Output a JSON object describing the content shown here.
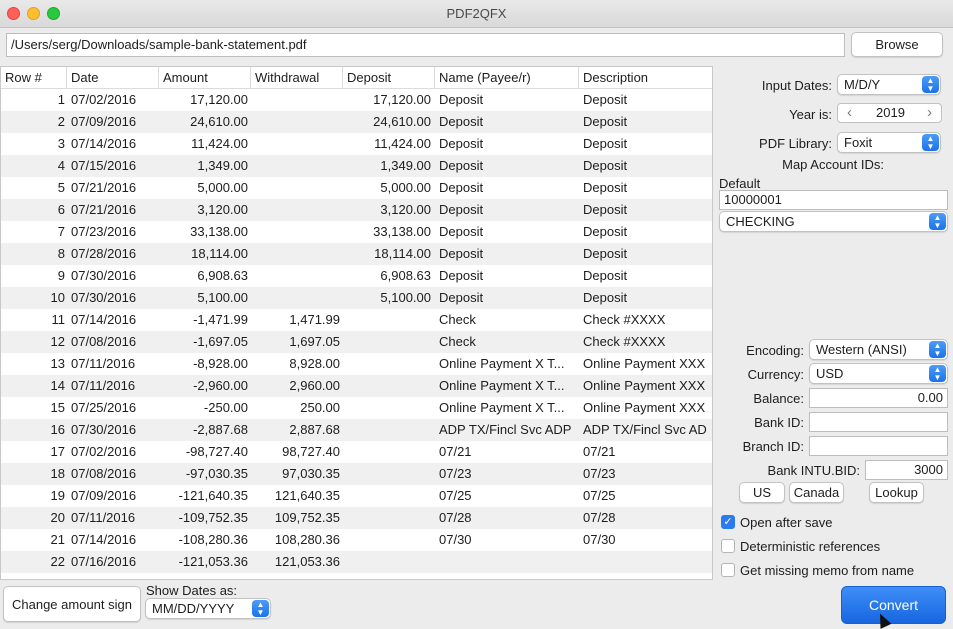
{
  "window": {
    "title": "PDF2QFX"
  },
  "file": {
    "path": "/Users/serg/Downloads/sample-bank-statement.pdf",
    "browse_label": "Browse"
  },
  "table": {
    "columns": [
      "Row #",
      "Date",
      "Amount",
      "Withdrawal",
      "Deposit",
      "Name (Payee/r)",
      "Description"
    ],
    "rows": [
      {
        "num": "1",
        "date": "07/02/2016",
        "amount": "17,120.00",
        "withdrawal": "",
        "deposit": "17,120.00",
        "name": "Deposit",
        "desc": "Deposit"
      },
      {
        "num": "2",
        "date": "07/09/2016",
        "amount": "24,610.00",
        "withdrawal": "",
        "deposit": "24,610.00",
        "name": "Deposit",
        "desc": "Deposit"
      },
      {
        "num": "3",
        "date": "07/14/2016",
        "amount": "11,424.00",
        "withdrawal": "",
        "deposit": "11,424.00",
        "name": "Deposit",
        "desc": "Deposit"
      },
      {
        "num": "4",
        "date": "07/15/2016",
        "amount": "1,349.00",
        "withdrawal": "",
        "deposit": "1,349.00",
        "name": "Deposit",
        "desc": "Deposit"
      },
      {
        "num": "5",
        "date": "07/21/2016",
        "amount": "5,000.00",
        "withdrawal": "",
        "deposit": "5,000.00",
        "name": "Deposit",
        "desc": "Deposit"
      },
      {
        "num": "6",
        "date": "07/21/2016",
        "amount": "3,120.00",
        "withdrawal": "",
        "deposit": "3,120.00",
        "name": "Deposit",
        "desc": "Deposit"
      },
      {
        "num": "7",
        "date": "07/23/2016",
        "amount": "33,138.00",
        "withdrawal": "",
        "deposit": "33,138.00",
        "name": "Deposit",
        "desc": "Deposit"
      },
      {
        "num": "8",
        "date": "07/28/2016",
        "amount": "18,114.00",
        "withdrawal": "",
        "deposit": "18,114.00",
        "name": "Deposit",
        "desc": "Deposit"
      },
      {
        "num": "9",
        "date": "07/30/2016",
        "amount": "6,908.63",
        "withdrawal": "",
        "deposit": "6,908.63",
        "name": "Deposit",
        "desc": "Deposit"
      },
      {
        "num": "10",
        "date": "07/30/2016",
        "amount": "5,100.00",
        "withdrawal": "",
        "deposit": "5,100.00",
        "name": "Deposit",
        "desc": "Deposit"
      },
      {
        "num": "11",
        "date": "07/14/2016",
        "amount": "-1,471.99",
        "withdrawal": "1,471.99",
        "deposit": "",
        "name": "Check",
        "desc": "Check #XXXX"
      },
      {
        "num": "12",
        "date": "07/08/2016",
        "amount": "-1,697.05",
        "withdrawal": "1,697.05",
        "deposit": "",
        "name": "Check",
        "desc": "Check #XXXX"
      },
      {
        "num": "13",
        "date": "07/11/2016",
        "amount": "-8,928.00",
        "withdrawal": "8,928.00",
        "deposit": "",
        "name": "Online Payment X T...",
        "desc": "Online Payment XXX"
      },
      {
        "num": "14",
        "date": "07/11/2016",
        "amount": "-2,960.00",
        "withdrawal": "2,960.00",
        "deposit": "",
        "name": "Online Payment X T...",
        "desc": "Online Payment XXX"
      },
      {
        "num": "15",
        "date": "07/25/2016",
        "amount": "-250.00",
        "withdrawal": "250.00",
        "deposit": "",
        "name": "Online Payment X T...",
        "desc": "Online Payment XXX"
      },
      {
        "num": "16",
        "date": "07/30/2016",
        "amount": "-2,887.68",
        "withdrawal": "2,887.68",
        "deposit": "",
        "name": "ADP TX/Fincl Svc ADP",
        "desc": "ADP TX/Fincl Svc AD"
      },
      {
        "num": "17",
        "date": "07/02/2016",
        "amount": "-98,727.40",
        "withdrawal": "98,727.40",
        "deposit": "",
        "name": "07/21",
        "desc": "07/21"
      },
      {
        "num": "18",
        "date": "07/08/2016",
        "amount": "-97,030.35",
        "withdrawal": "97,030.35",
        "deposit": "",
        "name": "07/23",
        "desc": "07/23"
      },
      {
        "num": "19",
        "date": "07/09/2016",
        "amount": "-121,640.35",
        "withdrawal": "121,640.35",
        "deposit": "",
        "name": "07/25",
        "desc": "07/25"
      },
      {
        "num": "20",
        "date": "07/11/2016",
        "amount": "-109,752.35",
        "withdrawal": "109,752.35",
        "deposit": "",
        "name": "07/28",
        "desc": "07/28"
      },
      {
        "num": "21",
        "date": "07/14/2016",
        "amount": "-108,280.36",
        "withdrawal": "108,280.36",
        "deposit": "",
        "name": "07/30",
        "desc": "07/30"
      },
      {
        "num": "22",
        "date": "07/16/2016",
        "amount": "-121,053.36",
        "withdrawal": "121,053.36",
        "deposit": "",
        "name": "",
        "desc": ""
      }
    ]
  },
  "settings": {
    "input_dates_label": "Input Dates:",
    "input_dates_value": "M/D/Y",
    "year_label": "Year is:",
    "year_value": "2019",
    "pdf_library_label": "PDF Library:",
    "pdf_library_value": "Foxit",
    "map_accounts_label": "Map Account IDs:",
    "default_label": "Default",
    "account_id": "10000001",
    "account_type": "CHECKING",
    "encoding_label": "Encoding:",
    "encoding_value": "Western (ANSI)",
    "currency_label": "Currency:",
    "currency_value": "USD",
    "balance_label": "Balance:",
    "balance_value": "0.00",
    "bank_id_label": "Bank ID:",
    "bank_id_value": "",
    "branch_id_label": "Branch ID:",
    "branch_id_value": "",
    "intu_bid_label": "Bank INTU.BID:",
    "intu_bid_value": "3000",
    "us_label": "US",
    "canada_label": "Canada",
    "lookup_label": "Lookup",
    "open_after_save_label": "Open after save",
    "open_after_save": true,
    "deterministic_label": "Deterministic references",
    "deterministic": false,
    "missing_memo_label": "Get missing memo from name",
    "missing_memo": false
  },
  "footer": {
    "change_sign_label": "Change amount sign",
    "show_dates_label": "Show Dates as:",
    "show_dates_value": "MM/DD/YYYY",
    "convert_label": "Convert"
  },
  "colors": {
    "accent": "#1a73e8",
    "alt_row": "#f0f0f0"
  }
}
